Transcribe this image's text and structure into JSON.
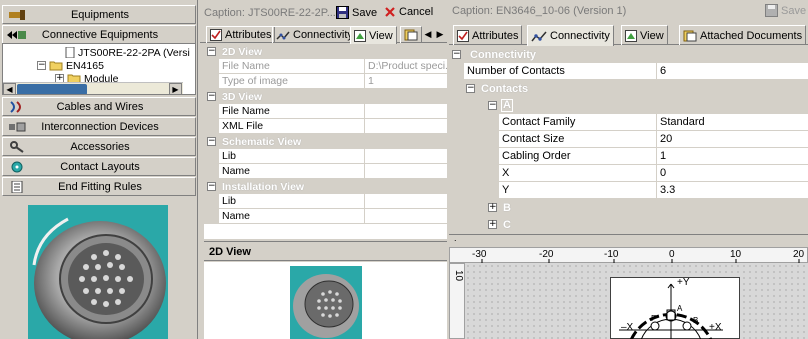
{
  "left_nav": {
    "equipments": "Equipments",
    "connective_equipments": "Connective Equipments",
    "cables_and_wires": "Cables and Wires",
    "interconnection_devices": "Interconnection Devices",
    "accessories": "Accessories",
    "contact_layouts": "Contact Layouts",
    "end_fitting_rules": "End Fitting Rules"
  },
  "tree": {
    "item1": "JTS00RE-22-2PA (Versi",
    "item2": "EN4165",
    "item3": "Module"
  },
  "middle": {
    "caption": "Caption:  JTS00RE-22-2P...",
    "save": "Save",
    "cancel": "Cancel",
    "tabs": [
      "Attributes",
      "Connectivity",
      "View"
    ],
    "grid": {
      "view2d": "2D View",
      "file_name_label": "File Name",
      "file_name_value": "D:\\Product speci...",
      "type_image_label": "Type of image",
      "type_image_value": "1",
      "view3d": "3D View",
      "file_name2": "File Name",
      "xml_file": "XML File",
      "schematic": "Schematic View",
      "lib1": "Lib",
      "name1": "Name",
      "installation": "Installation View",
      "lib2": "Lib",
      "name2": "Name"
    },
    "preview_title": "2D View"
  },
  "right": {
    "caption": "Caption:  EN3646_10-06 (Version 1)",
    "save": "Save",
    "tabs": [
      "Attributes",
      "Connectivity",
      "View",
      "Attached Documents"
    ],
    "grid": {
      "connectivity": "Connectivity",
      "num_contacts_label": "Number of Contacts",
      "num_contacts_value": "6",
      "contacts": "Contacts",
      "a": "A",
      "contact_family_label": "Contact Family",
      "contact_family_value": "Standard",
      "contact_size_label": "Contact Size",
      "contact_size_value": "20",
      "cabling_order_label": "Cabling Order",
      "cabling_order_value": "1",
      "x_label": "X",
      "x_value": "0",
      "y_label": "Y",
      "y_value": "3.3",
      "b": "B",
      "c": "C"
    },
    "ruler_ticks": [
      "-30",
      "-20",
      "-10",
      "0",
      "10",
      "20"
    ],
    "diagram": {
      "plus_y": "+Y",
      "minus_x": "–X",
      "plus_x": "+X",
      "f": "F",
      "a": "A",
      "b": "B"
    }
  },
  "colors": {
    "window_bg": "#d4d0c8",
    "teal": "#2aa8a8"
  }
}
